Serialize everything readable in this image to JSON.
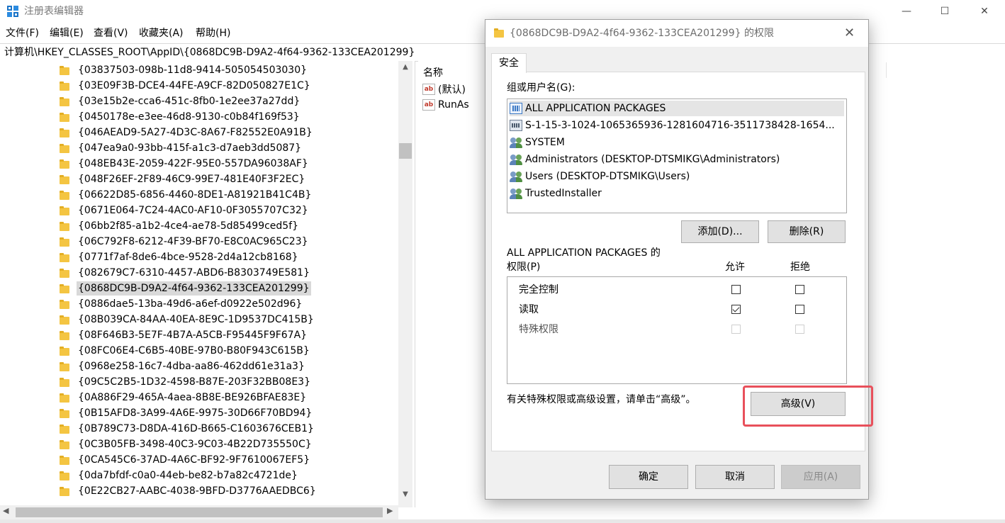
{
  "app": {
    "title": "注册表编辑器",
    "window_controls": {
      "minimize": "—",
      "maximize": "☐",
      "close": "✕"
    }
  },
  "menu": [
    "文件(F)",
    "编辑(E)",
    "查看(V)",
    "收藏夹(A)",
    "帮助(H)"
  ],
  "address": "计算机\\HKEY_CLASSES_ROOT\\AppID\\{0868DC9B-D9A2-4f64-9362-133CEA201299}",
  "tree": {
    "selected_index": 14,
    "items": [
      "{03837503-098b-11d8-9414-505054503030}",
      "{03E09F3B-DCE4-44FE-A9CF-82D050827E1C}",
      "{03e15b2e-cca6-451c-8fb0-1e2ee37a27dd}",
      "{0450178e-e3ee-46d8-9130-c0b84f169f53}",
      "{046AEAD9-5A27-4D3C-8A67-F82552E0A91B}",
      "{047ea9a0-93bb-415f-a1c3-d7aeb3dd5087}",
      "{048EB43E-2059-422F-95E0-557DA96038AF}",
      "{048F26EF-2F89-46C9-99E7-481E40F3F2EC}",
      "{06622D85-6856-4460-8DE1-A81921B41C4B}",
      "{0671E064-7C24-4AC0-AF10-0F3055707C32}",
      "{06bb2f85-a1b2-4ce4-ae78-5d85499ced5f}",
      "{06C792F8-6212-4F39-BF70-E8C0AC965C23}",
      "{0771f7af-8de6-4bce-9528-2d4a12cb8168}",
      "{082679C7-6310-4457-ABD6-B8303749E581}",
      "{0868DC9B-D9A2-4f64-9362-133CEA201299}",
      "{0886dae5-13ba-49d6-a6ef-d0922e502d96}",
      "{08B039CA-84AA-40EA-8E9C-1D9537DC415B}",
      "{08F646B3-5E7F-4B7A-A5CB-F95445F9F67A}",
      "{08FC06E4-C6B5-40BE-97B0-B80F943C615B}",
      "{0968e258-16c7-4dba-aa86-462dd61e31a3}",
      "{09C5C2B5-1D32-4598-B87E-203F32BB08E3}",
      "{0A886F29-465A-4aea-8B8E-BE926BFAE83E}",
      "{0B15AFD8-3A99-4A6E-9975-30D66F70BD94}",
      "{0B789C73-D8DA-416D-B665-C1603676CEB1}",
      "{0C3B05FB-3498-40C3-9C03-4B22D735550C}",
      "{0CA545C6-37AD-4A6C-BF92-9F7610067EF5}",
      "{0da7bfdf-c0a0-44eb-be82-b7a82c4721de}",
      "{0E22CB27-AABC-4038-9BFD-D3776AAEDBC6}"
    ]
  },
  "values_pane": {
    "column_name": "名称",
    "rows": [
      {
        "icon": "ab",
        "name": "(默认)"
      },
      {
        "icon": "ab",
        "name": "RunAs"
      }
    ]
  },
  "dialog": {
    "title": "{0868DC9B-D9A2-4f64-9362-133CEA201299} 的权限",
    "close": "✕",
    "tab": "安全",
    "group_label": "组或用户名(G):",
    "users": [
      {
        "icon": "package-icon",
        "name": "ALL APPLICATION PACKAGES",
        "selected": true
      },
      {
        "icon": "sid-icon",
        "name": "S-1-15-3-1024-1065365936-1281604716-3511738428-1654..."
      },
      {
        "icon": "users-group-icon",
        "name": "SYSTEM"
      },
      {
        "icon": "users-group-icon",
        "name": "Administrators (DESKTOP-DTSMIKG\\Administrators)"
      },
      {
        "icon": "users-group-icon",
        "name": "Users (DESKTOP-DTSMIKG\\Users)"
      },
      {
        "icon": "users-group-icon",
        "name": "TrustedInstaller"
      }
    ],
    "add_button": "添加(D)...",
    "remove_button": "删除(R)",
    "perm_heading": "ALL APPLICATION PACKAGES 的",
    "perm_label": "权限(P)",
    "allow_col": "允许",
    "deny_col": "拒绝",
    "permissions": [
      {
        "name": "完全控制",
        "allow": false,
        "deny": false,
        "enabled": true
      },
      {
        "name": "读取",
        "allow": true,
        "deny": false,
        "enabled": true
      },
      {
        "name": "特殊权限",
        "allow": false,
        "deny": false,
        "enabled": false
      }
    ],
    "advanced_note": "有关特殊权限或高级设置，请单击“高级”。",
    "advanced_button": "高级(V)",
    "ok_button": "确定",
    "cancel_button": "取消",
    "apply_button": "应用(A)",
    "highlight_color": "#e8505b"
  }
}
